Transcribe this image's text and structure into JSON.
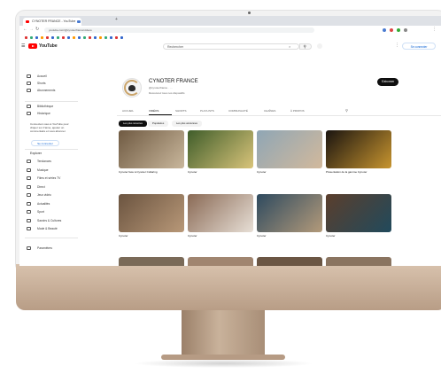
{
  "browser": {
    "tab_active": "CYNOTER FRANCE - YouTube",
    "tab_second": "",
    "url": "youtube.com/@cynoterfrance/videos"
  },
  "youtube": {
    "logo_text": "YouTube",
    "search_placeholder": "Rechercher",
    "signin_label": "Se connecter"
  },
  "sidebar": {
    "items_top": [
      {
        "label": "Accueil",
        "icon": "home-icon"
      },
      {
        "label": "Shorts",
        "icon": "shorts-icon"
      },
      {
        "label": "Abonnements",
        "icon": "subscriptions-icon"
      }
    ],
    "items_you": [
      {
        "label": "Bibliothèque",
        "icon": "library-icon"
      },
      {
        "label": "Historique",
        "icon": "history-icon"
      }
    ],
    "signin_prompt": "Connectez-vous à YouTube pour cliquer sur J'aime, ajouter un commentaire et vous abonner.",
    "signin_label": "Se connecter",
    "explore_heading": "Explorer",
    "items_explore": [
      {
        "label": "Tendances",
        "icon": "trending-icon"
      },
      {
        "label": "Musique",
        "icon": "music-icon"
      },
      {
        "label": "Films et séries TV",
        "icon": "films-icon"
      },
      {
        "label": "Direct",
        "icon": "live-icon"
      },
      {
        "label": "Jeux vidéo",
        "icon": "gaming-icon"
      },
      {
        "label": "Actualités",
        "icon": "news-icon"
      },
      {
        "label": "Sport",
        "icon": "sports-icon"
      },
      {
        "label": "Savoirs & Cultures",
        "icon": "learning-icon"
      },
      {
        "label": "Mode & Beauté",
        "icon": "fashion-icon"
      }
    ],
    "items_bottom": [
      {
        "label": "Paramètres",
        "icon": "settings-icon"
      }
    ]
  },
  "channel": {
    "name": "CYNOTER FRANCE",
    "meta": "@cynoterfrance  ·  …",
    "description": "Découvrez tous nos dispositifs",
    "subscribe_label": "S'abonner",
    "tabs": [
      "ACCUEIL",
      "VIDÉOS",
      "SHORTS",
      "PLAYLISTS",
      "COMMUNAUTÉ",
      "CHAÎNES",
      "À PROPOS"
    ],
    "active_tab_index": 1,
    "chips": [
      "Les plus récentes",
      "Populaires",
      "Les plus anciennes"
    ],
    "active_chip_index": 0
  },
  "videos": [
    {
      "title": "Cynoter face à Cynoter Collaring",
      "meta": "",
      "duration": "",
      "colors": [
        "#6f5a42",
        "#c9b79c"
      ],
      "overlay": ""
    },
    {
      "title": "Cynoter",
      "meta": "",
      "duration": "",
      "colors": [
        "#3f5d2a",
        "#d9c47a"
      ],
      "overlay": ""
    },
    {
      "title": "Cynoter",
      "meta": "",
      "duration": "",
      "colors": [
        "#8fa6b5",
        "#d2b99c"
      ],
      "overlay": ""
    },
    {
      "title": "Présentation de la gamme Cynoter",
      "meta": "",
      "duration": "",
      "colors": [
        "#1a1410",
        "#c8952f"
      ],
      "overlay": ""
    },
    {
      "title": "Cynoter",
      "meta": "",
      "duration": "",
      "colors": [
        "#6b5440",
        "#b89878"
      ],
      "overlay": ""
    },
    {
      "title": "Cynoter",
      "meta": "",
      "duration": "",
      "colors": [
        "#8a6a55",
        "#e7dfd6"
      ],
      "overlay": ""
    },
    {
      "title": "Cynoter",
      "meta": "",
      "duration": "",
      "colors": [
        "#2e4a5f",
        "#b39a7a"
      ],
      "overlay": ""
    },
    {
      "title": "Cynoter",
      "meta": "",
      "duration": "",
      "colors": [
        "#5b3e2c",
        "#214a5c"
      ],
      "overlay": ""
    }
  ]
}
